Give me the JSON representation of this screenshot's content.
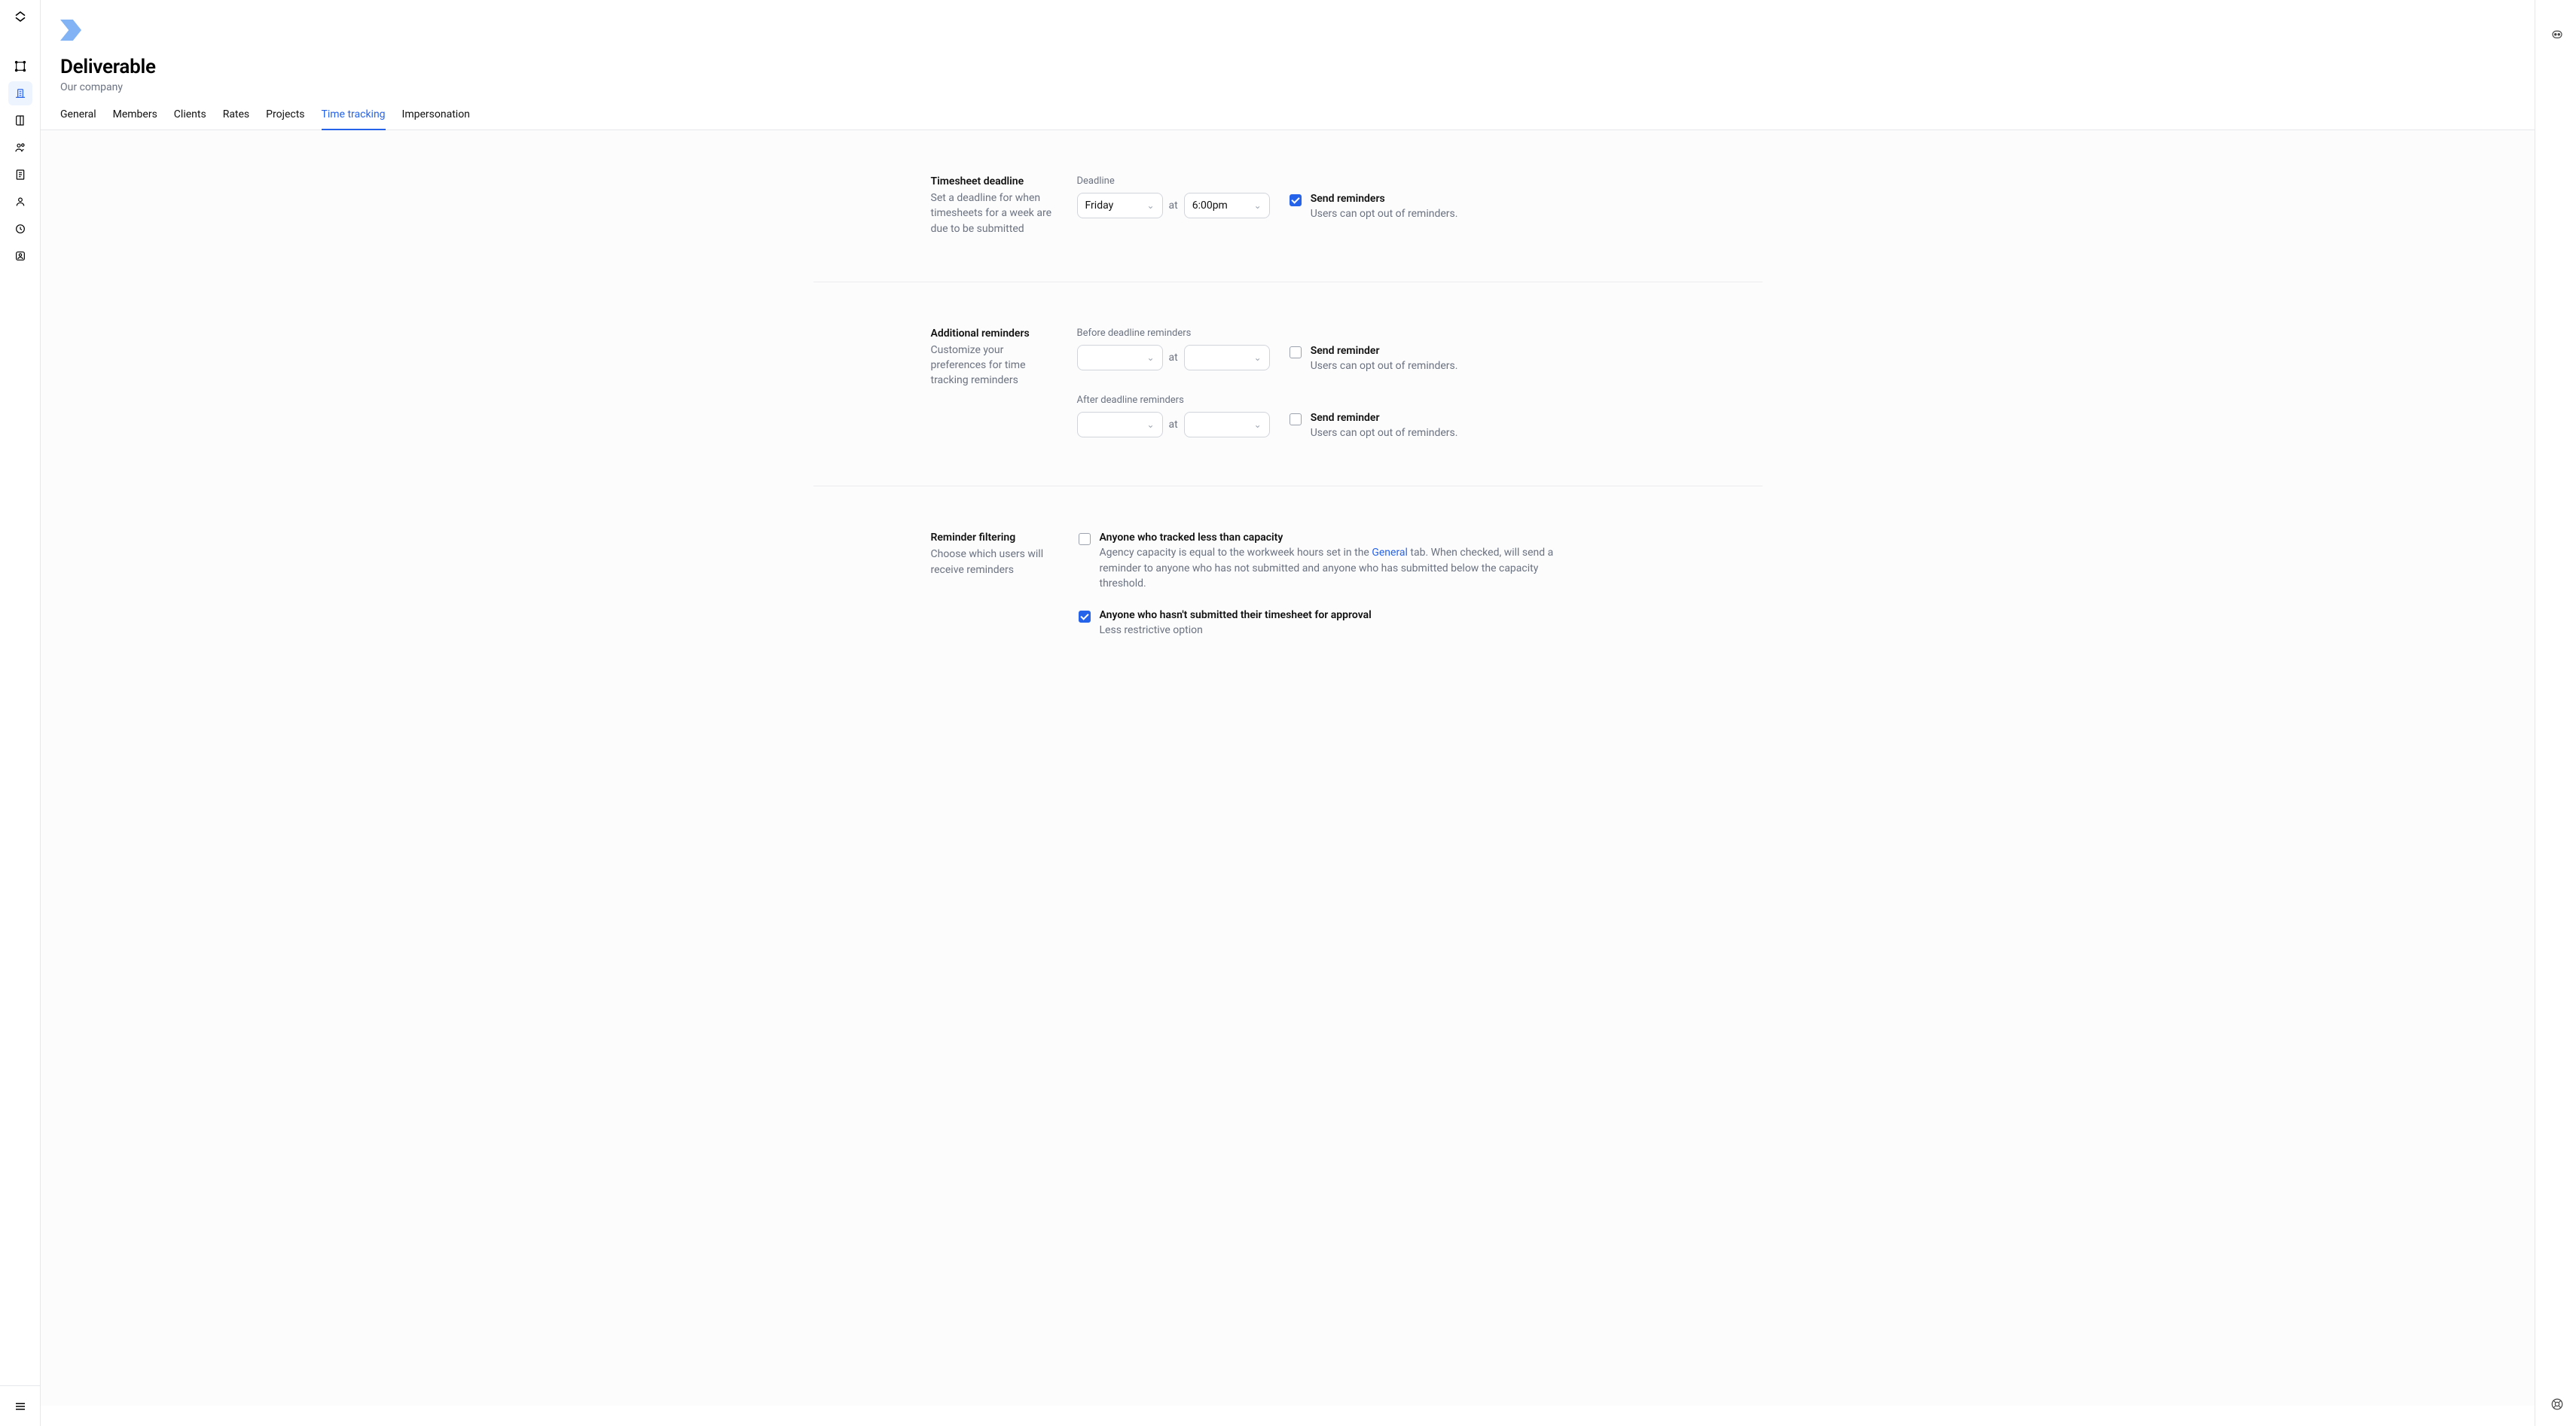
{
  "page": {
    "title": "Deliverable",
    "subtitle": "Our company"
  },
  "tabs": [
    {
      "id": "general",
      "label": "General"
    },
    {
      "id": "members",
      "label": "Members"
    },
    {
      "id": "clients",
      "label": "Clients"
    },
    {
      "id": "rates",
      "label": "Rates"
    },
    {
      "id": "projects",
      "label": "Projects"
    },
    {
      "id": "time-tracking",
      "label": "Time tracking"
    },
    {
      "id": "impersonation",
      "label": "Impersonation"
    }
  ],
  "active_tab": "time-tracking",
  "sections": {
    "deadline": {
      "title": "Timesheet deadline",
      "desc": "Set a deadline for when timesheets for a week are due to be submitted",
      "field_label": "Deadline",
      "day": "Friday",
      "at": "at",
      "time": "6:00pm",
      "opt_title": "Send reminders",
      "opt_desc": "Users can opt out of reminders.",
      "opt_checked": true
    },
    "additional": {
      "title": "Additional reminders",
      "desc": "Customize your preferences for time tracking reminders",
      "before_label": "Before deadline reminders",
      "after_label": "After deadline reminders",
      "at": "at",
      "before_day": "",
      "before_time": "",
      "after_day": "",
      "after_time": "",
      "before_opt_title": "Send reminder",
      "before_opt_desc": "Users can opt out of reminders.",
      "before_opt_checked": false,
      "after_opt_title": "Send reminder",
      "after_opt_desc": "Users can opt out of reminders.",
      "after_opt_checked": false
    },
    "filtering": {
      "title": "Reminder filtering",
      "desc": "Choose which users will receive reminders",
      "rows": [
        {
          "checked": false,
          "title": "Anyone who tracked less than capacity",
          "desc_pre": "Agency capacity is equal to the workweek hours set in the ",
          "link_text": "General",
          "desc_post": " tab. When checked, will send a reminder to anyone who has not submitted and anyone who has submitted below the capacity threshold."
        },
        {
          "checked": true,
          "title": "Anyone who hasn't submitted their timesheet for approval",
          "desc": "Less restrictive option"
        }
      ]
    }
  }
}
